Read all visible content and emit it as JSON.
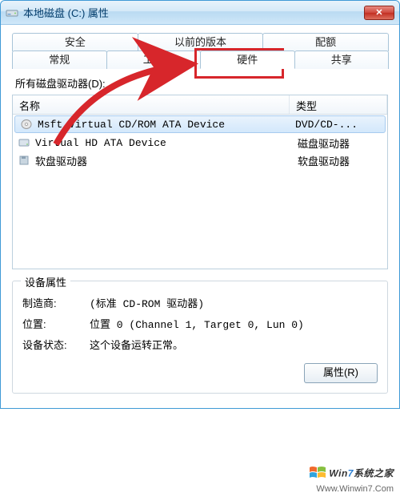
{
  "window": {
    "title": "本地磁盘 (C:) 属性",
    "close_glyph": "✕"
  },
  "tabs": {
    "row1": [
      "安全",
      "以前的版本",
      "配额"
    ],
    "row2": [
      "常规",
      "工具",
      "硬件",
      "共享"
    ],
    "active": "硬件"
  },
  "drives_label": "所有磁盘驱动器(D):",
  "list": {
    "headers": {
      "name": "名称",
      "type": "类型"
    },
    "rows": [
      {
        "name": "Msft Virtual CD/ROM ATA Device",
        "type": "DVD/CD-...",
        "selected": true,
        "icon": "cdrom"
      },
      {
        "name": "Virtual HD ATA Device",
        "type": "磁盘驱动器",
        "selected": false,
        "icon": "hdd"
      },
      {
        "name": "软盘驱动器",
        "type": "软盘驱动器",
        "selected": false,
        "icon": "floppy"
      }
    ]
  },
  "group": {
    "legend": "设备属性",
    "manufacturer_k": "制造商:",
    "manufacturer_v": "(标准 CD-ROM 驱动器)",
    "location_k": "位置:",
    "location_v": "位置 0 (Channel 1, Target 0, Lun 0)",
    "status_k": "设备状态:",
    "status_v": "这个设备运转正常。",
    "props_btn": "属性(R)"
  },
  "watermark": {
    "text_prefix": "Win",
    "text_seven": "7",
    "text_suffix": "系统之家",
    "url": "Www.Winwin7.Com"
  }
}
